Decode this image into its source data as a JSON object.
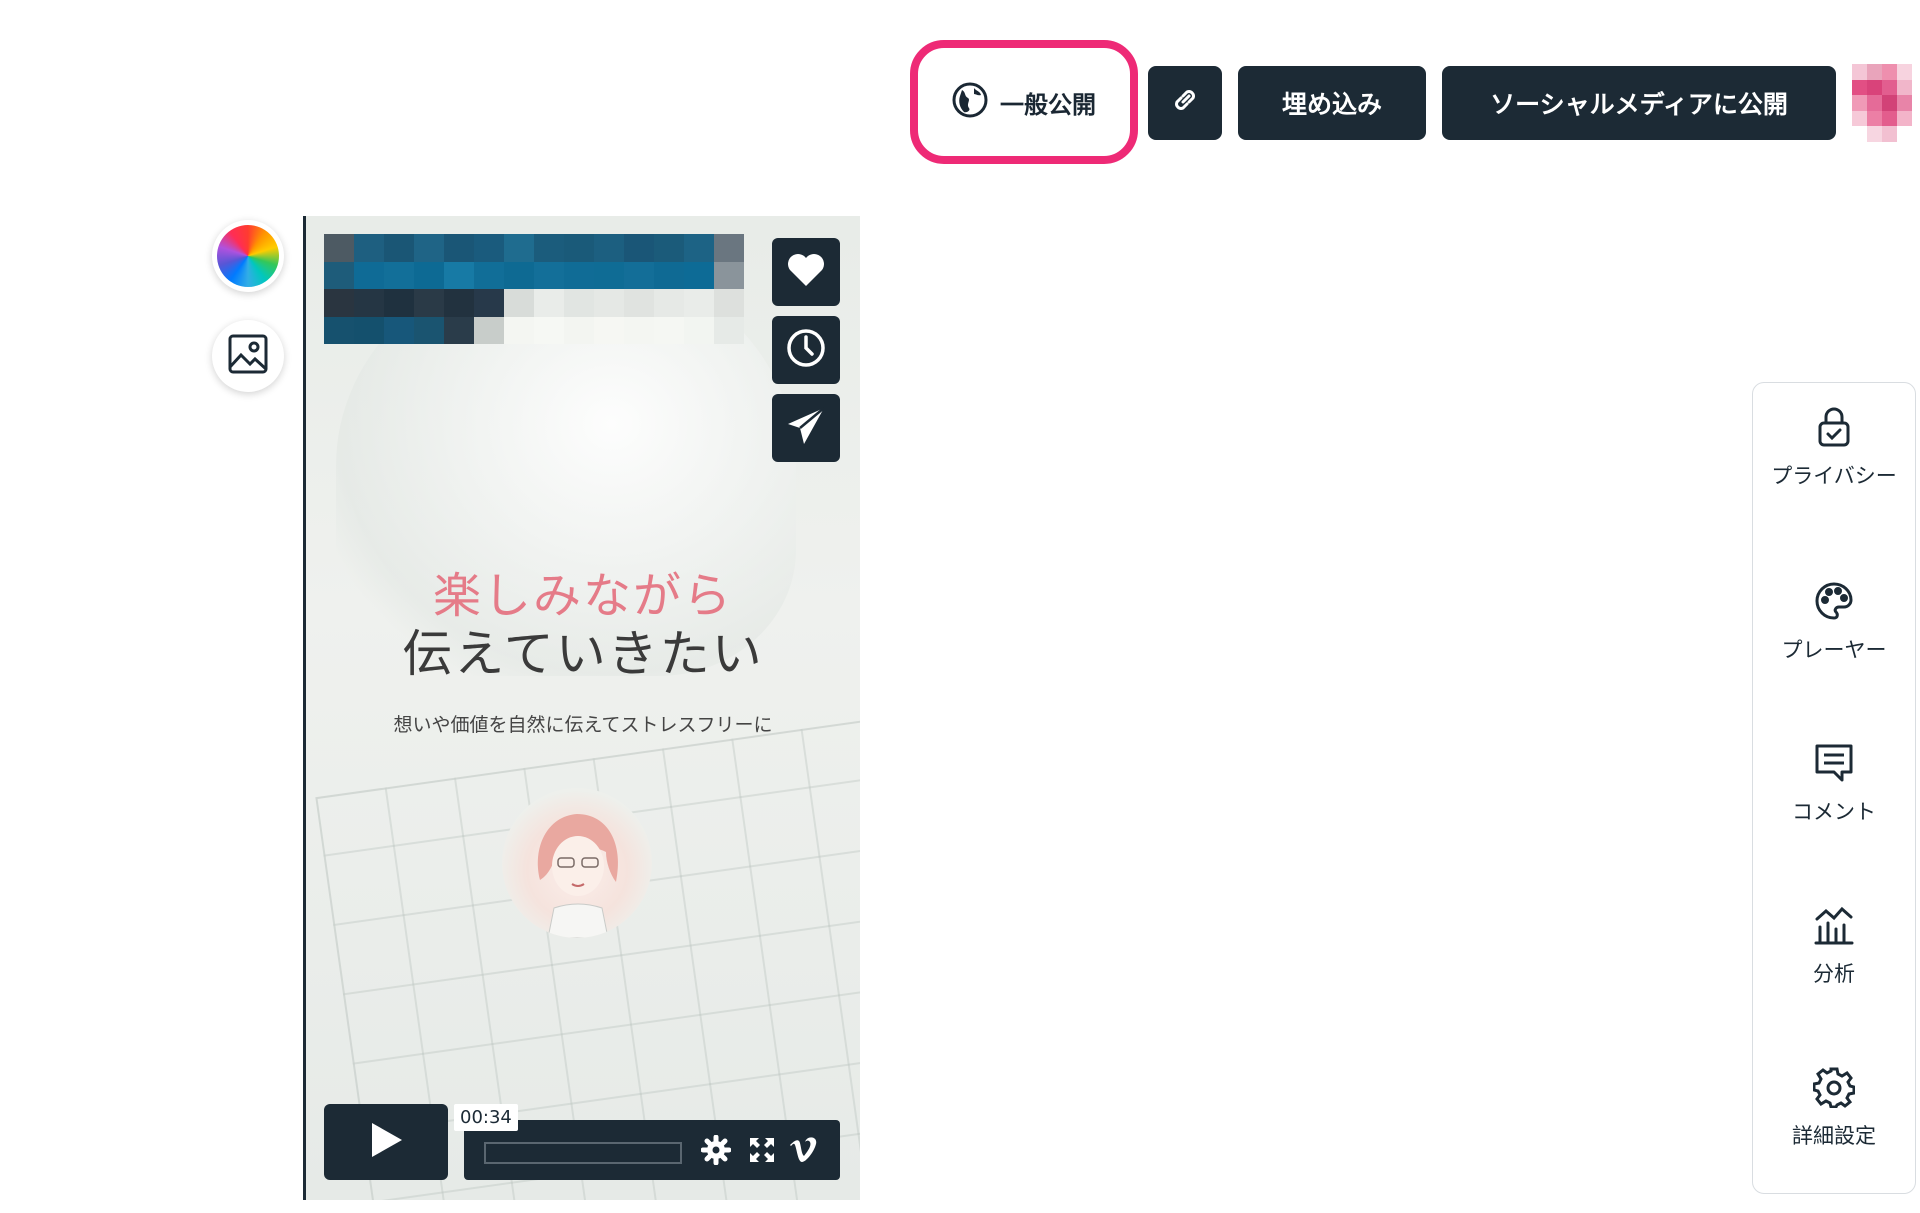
{
  "header": {
    "public_label": "一般公開",
    "embed_label": "埋め込み",
    "social_label": "ソーシャルメディアに公開"
  },
  "video": {
    "headline_pink": "楽しみながら",
    "headline_dark": "伝えていきたい",
    "subline": "想いや価値を自然に伝えてストレスフリーに",
    "time": "00:34"
  },
  "right_panel": {
    "items": [
      {
        "label": "プライバシー",
        "icon": "lock-icon"
      },
      {
        "label": "プレーヤー",
        "icon": "palette-icon"
      },
      {
        "label": "コメント",
        "icon": "comment-icon"
      },
      {
        "label": "分析",
        "icon": "analytics-icon"
      },
      {
        "label": "詳細設定",
        "icon": "gear-icon"
      }
    ]
  },
  "colors": {
    "accent_highlight": "#ee2a76",
    "dark_button": "#1c2a35",
    "headline_pink": "#e57b88"
  }
}
